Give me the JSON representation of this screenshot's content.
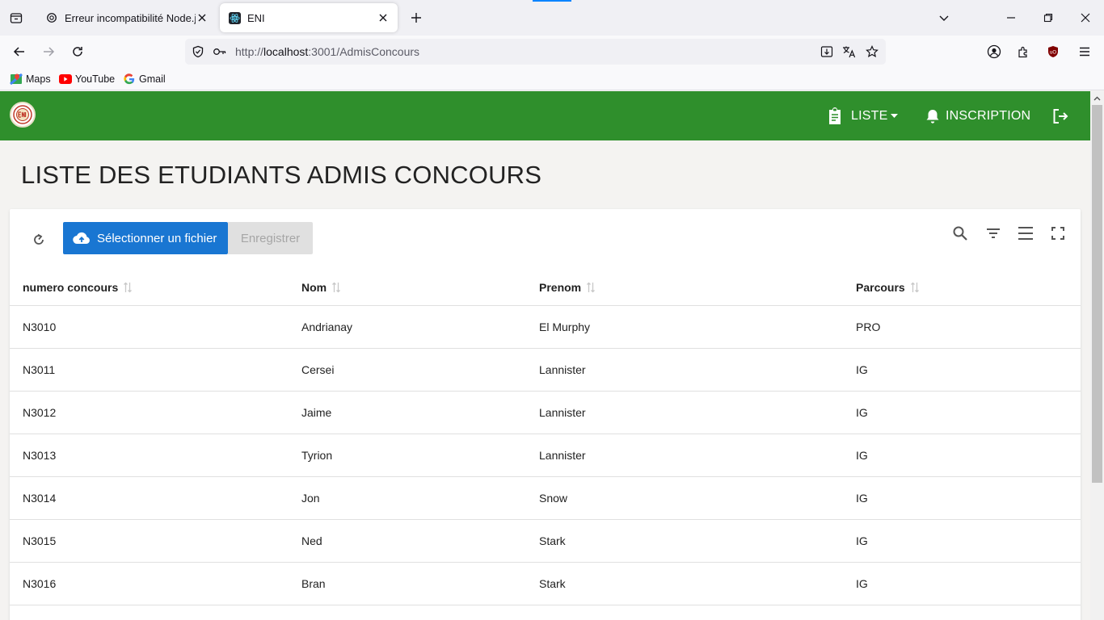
{
  "browser": {
    "tabs": [
      {
        "title": "Erreur incompatibilité Node.js"
      },
      {
        "title": "ENI"
      }
    ],
    "url_prefix": "http://",
    "url_host": "localhost",
    "url_path": ":3001/AdmisConcours",
    "bookmarks": [
      {
        "label": "Maps"
      },
      {
        "label": "YouTube"
      },
      {
        "label": "Gmail"
      }
    ]
  },
  "appbar": {
    "menu_liste": "LISTE",
    "menu_inscription": "INSCRIPTION",
    "color": "#2f8f2c"
  },
  "page": {
    "title": "LISTE DES ETUDIANTS ADMIS CONCOURS"
  },
  "toolbar": {
    "upload_label": "Sélectionner un fichier",
    "save_label": "Enregistrer"
  },
  "table": {
    "columns": [
      "numero concours",
      "Nom",
      "Prenom",
      "Parcours"
    ],
    "rows": [
      [
        "N3010",
        "Andrianay",
        "El Murphy",
        "PRO"
      ],
      [
        "N3011",
        "Cersei",
        "Lannister",
        "IG"
      ],
      [
        "N3012",
        "Jaime",
        "Lannister",
        "IG"
      ],
      [
        "N3013",
        "Tyrion",
        "Lannister",
        "IG"
      ],
      [
        "N3014",
        "Jon",
        "Snow",
        "IG"
      ],
      [
        "N3015",
        "Ned",
        "Stark",
        "IG"
      ],
      [
        "N3016",
        "Bran",
        "Stark",
        "IG"
      ],
      [
        "",
        "",
        "",
        ""
      ]
    ]
  }
}
